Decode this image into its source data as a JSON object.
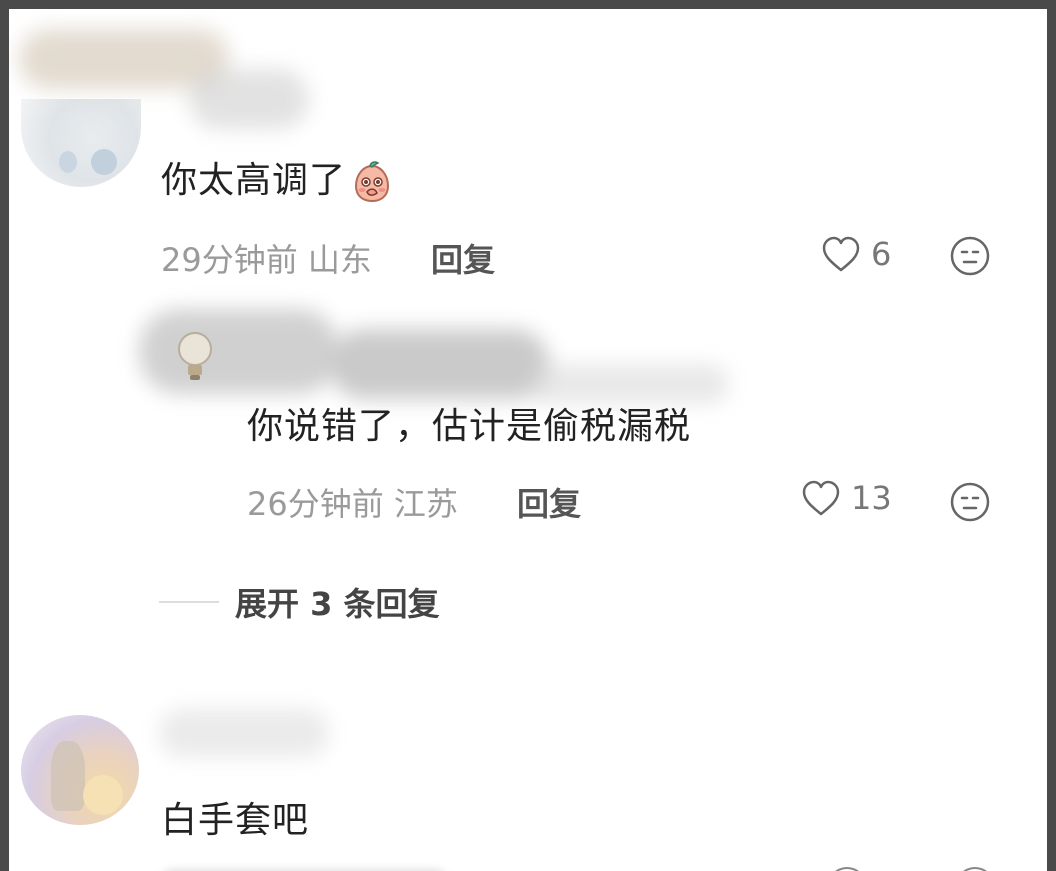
{
  "comments": [
    {
      "text": "你太高调了",
      "emoji": "shy-peach-emoji",
      "time": "29分钟前",
      "location": "山东",
      "reply_label": "回复",
      "likes": "6"
    },
    {
      "text": "你说错了，估计是偷税漏税",
      "time": "26分钟前",
      "location": "江苏",
      "reply_label": "回复",
      "likes": "13"
    },
    {
      "text": "白手套吧"
    }
  ],
  "expand_replies": {
    "label": "展开 3 条回复"
  },
  "colors": {
    "border": "#4a4a4a",
    "meta_text": "#9a9a9a",
    "main_text": "#222222"
  }
}
